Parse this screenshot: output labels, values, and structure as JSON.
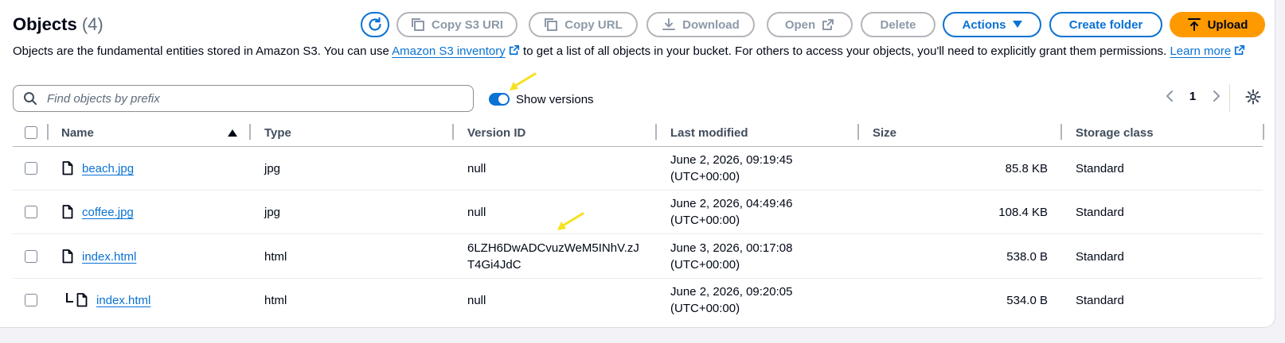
{
  "header": {
    "title": "Objects",
    "count": "(4)",
    "buttons": {
      "copy_s3_uri": "Copy S3 URI",
      "copy_url": "Copy URL",
      "download": "Download",
      "open": "Open",
      "delete": "Delete",
      "actions": "Actions",
      "create_folder": "Create folder",
      "upload": "Upload"
    }
  },
  "description": {
    "before": "Objects are the fundamental entities stored in Amazon S3. You can use ",
    "link1": "Amazon S3 inventory",
    "middle": " to get a list of all objects in your bucket. For others to access your objects, you'll need to explicitly grant them permissions. ",
    "link2a": "Learn",
    "link2b": "more"
  },
  "search": {
    "placeholder": "Find objects by prefix"
  },
  "show_versions": {
    "label": "Show versions",
    "on": true
  },
  "pagination": {
    "current_page": "1"
  },
  "table": {
    "columns": [
      "Name",
      "Type",
      "Version ID",
      "Last modified",
      "Size",
      "Storage class"
    ],
    "rows": [
      {
        "name": "beach.jpg",
        "type": "jpg",
        "version_id_1": "null",
        "version_id_2": "",
        "modified_1": "June 2, 2026, 09:19:45",
        "modified_2": "(UTC+00:00)",
        "size": "85.8 KB",
        "storage": "Standard"
      },
      {
        "name": "coffee.jpg",
        "type": "jpg",
        "version_id_1": "null",
        "version_id_2": "",
        "modified_1": "June 2, 2026, 04:49:46",
        "modified_2": "(UTC+00:00)",
        "size": "108.4 KB",
        "storage": "Standard"
      },
      {
        "name": "index.html",
        "type": "html",
        "version_id_1": "6LZH6DwADCvuzWeM5INhV.zJ",
        "version_id_2": "T4Gi4JdC",
        "modified_1": "June 3, 2026, 00:17:08",
        "modified_2": "(UTC+00:00)",
        "size": "538.0 B",
        "storage": "Standard"
      },
      {
        "name": "index.html",
        "type": "html",
        "version_id_1": "null",
        "version_id_2": "",
        "modified_1": "June 2, 2026, 09:20:05",
        "modified_2": "(UTC+00:00)",
        "size": "534.0 B",
        "storage": "Standard"
      }
    ]
  },
  "colors": {
    "accent": "#0972d3",
    "upload": "#ff9900",
    "annotation": "#f5e11e"
  }
}
